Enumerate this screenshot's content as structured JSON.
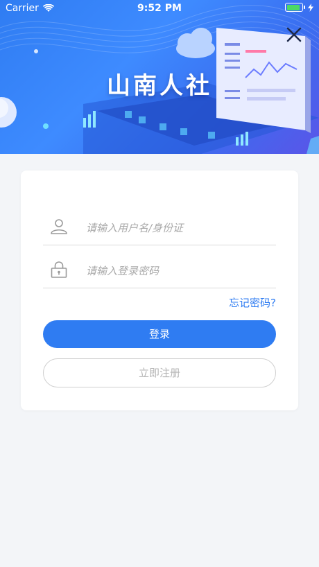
{
  "status_bar": {
    "carrier": "Carrier",
    "time": "9:52 PM",
    "battery_color": "#4cd964"
  },
  "header": {
    "title": "山南人社",
    "close_icon": "close-icon",
    "background_color": "#2f7cf2"
  },
  "login_form": {
    "username_placeholder": "请输入用户名/身份证",
    "password_placeholder": "请输入登录密码",
    "username_icon": "user-icon",
    "password_icon": "lock-icon",
    "forgot_password_label": "忘记密码?",
    "login_label": "登录",
    "register_label": "立即注册",
    "accent_color": "#2f7cf2"
  }
}
